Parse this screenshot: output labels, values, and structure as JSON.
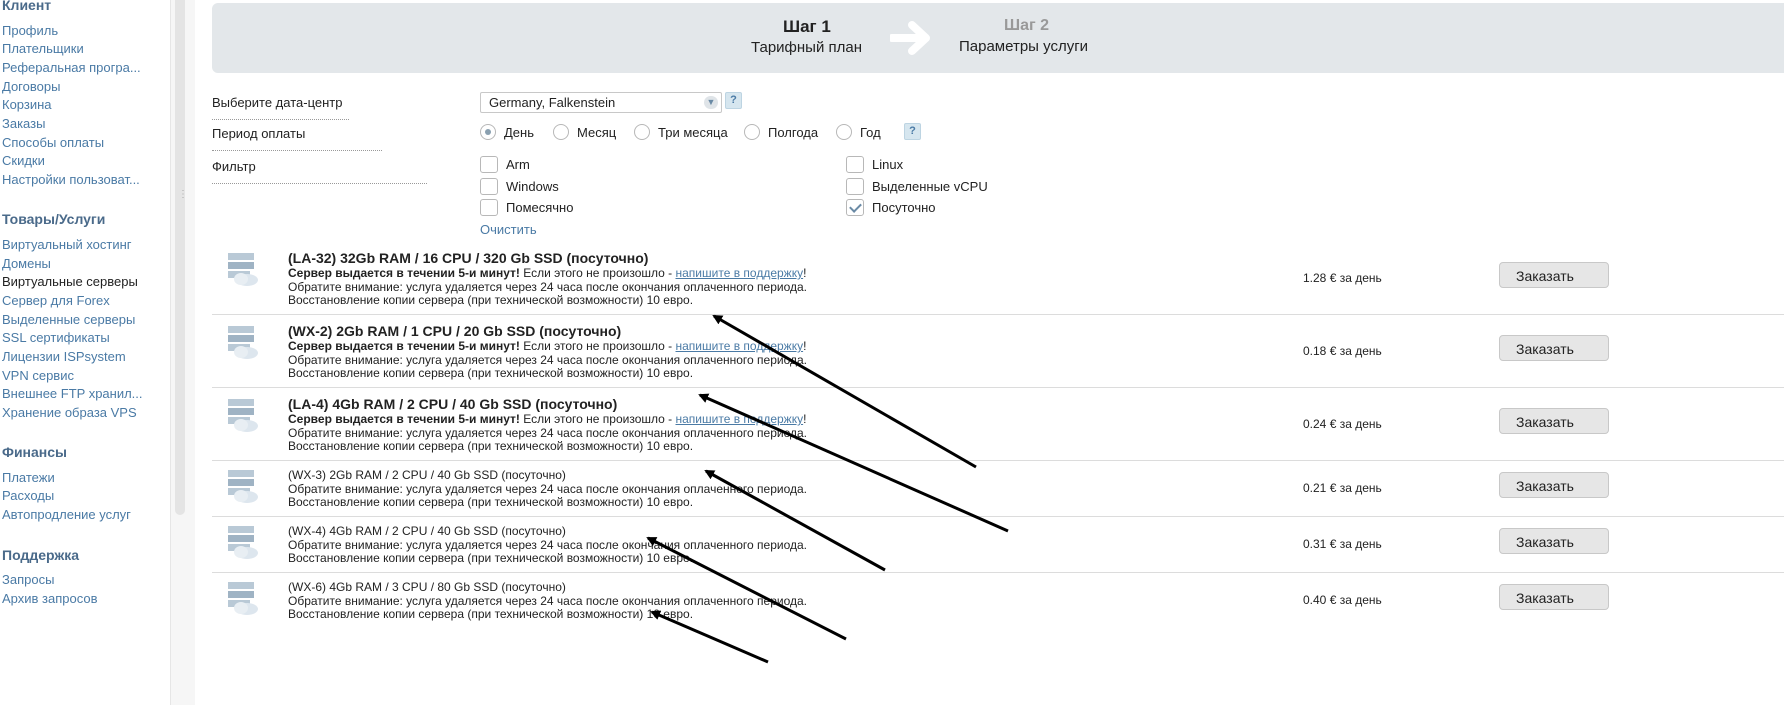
{
  "sidebar": {
    "sections": [
      {
        "title": "Клиент",
        "items": [
          "Профиль",
          "Плательщики",
          "Реферальная програ...",
          "Договоры",
          "Корзина",
          "Заказы",
          "Способы оплаты",
          "Скидки",
          "Настройки пользоват..."
        ]
      },
      {
        "title": "Товары/Услуги",
        "items": [
          "Виртуальный хостинг",
          "Домены",
          "Виртуальные серверы",
          "Сервер для Forex",
          "Выделенные серверы",
          "SSL сертификаты",
          "Лицензии ISPsystem",
          "VPN сервис",
          "Внешнее FTP хранил...",
          "Хранение образа VPS"
        ]
      },
      {
        "title": "Финансы",
        "items": [
          "Платежи",
          "Расходы",
          "Автопродление услуг"
        ]
      },
      {
        "title": "Поддержка",
        "items": [
          "Запросы",
          "Архив запросов"
        ]
      }
    ],
    "active_item": "Виртуальные серверы"
  },
  "steps": {
    "step1_title": "Шаг 1",
    "step1_sub": "Тарифный план",
    "step2_title": "Шаг 2",
    "step2_sub": "Параметры услуги"
  },
  "form": {
    "datacenter_label": "Выберите дата-центр",
    "datacenter_value": "Germany, Falkenstein",
    "period_label": "Период оплаты",
    "period_options": [
      "День",
      "Месяц",
      "Три месяца",
      "Полгода",
      "Год"
    ],
    "period_selected": "День",
    "filter_label": "Фильтр",
    "filters": [
      {
        "label": "Arm",
        "checked": false
      },
      {
        "label": "Windows",
        "checked": false
      },
      {
        "label": "Помесячно",
        "checked": false
      },
      {
        "label": "Linux",
        "checked": false
      },
      {
        "label": "Выделенные vCPU",
        "checked": false
      },
      {
        "label": "Посуточно",
        "checked": true
      }
    ],
    "clear_label": "Очистить",
    "help_label": "?"
  },
  "products": [
    {
      "title": "(LA-32) 32Gb RAM / 16 CPU / 320 Gb SSD (посуточно)",
      "featured": true,
      "price": "1.28 € за день"
    },
    {
      "title": "(WX-2) 2Gb RAM / 1 CPU / 20 Gb SSD (посуточно)",
      "featured": true,
      "price": "0.18 € за день"
    },
    {
      "title": "(LA-4) 4Gb RAM / 2 CPU / 40 Gb SSD (посуточно)",
      "featured": true,
      "price": "0.24 € за день"
    },
    {
      "title": "(WX-3) 2Gb RAM / 2 CPU / 40 Gb SSD (посуточно)",
      "featured": false,
      "price": "0.21 € за день"
    },
    {
      "title": "(WX-4) 4Gb RAM / 2 CPU / 40 Gb SSD (посуточно)",
      "featured": false,
      "price": "0.31 € за день"
    },
    {
      "title": "(WX-6) 4Gb RAM / 3 CPU / 80 Gb SSD (посуточно)",
      "featured": false,
      "price": "0.40 € за день"
    }
  ],
  "product_text": {
    "fast_bold": "Сервер выдается в течении 5-и минут!",
    "fast_rest": " Если этого не произошло - ",
    "support_link": "напишите в поддержку",
    "exclaim": "!",
    "notice": "Обратите внимание: услуга удаляется через 24 часа после окончания оплаченного периода.",
    "restore": "Восстановление копии сервера (при технической возможности) 10 евро.",
    "order_button": "Заказать"
  },
  "colors": {
    "link": "#4a7aa5",
    "steps_bg": "#e3e7ea",
    "annotation_arrow": "#000000"
  }
}
